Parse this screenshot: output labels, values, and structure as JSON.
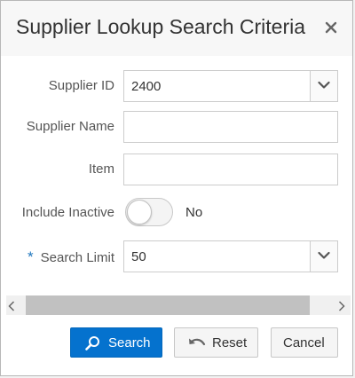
{
  "dialog": {
    "title": "Supplier Lookup Search Criteria"
  },
  "form": {
    "supplier_id": {
      "label": "Supplier ID",
      "value": "2400"
    },
    "supplier_name": {
      "label": "Supplier Name",
      "value": ""
    },
    "item": {
      "label": "Item",
      "value": ""
    },
    "include_inactive": {
      "label": "Include Inactive",
      "state": "No"
    },
    "search_limit": {
      "label": "Search Limit",
      "required_marker": "*",
      "value": "50"
    }
  },
  "buttons": {
    "search": "Search",
    "reset": "Reset",
    "cancel": "Cancel"
  },
  "colors": {
    "primary": "#0572ce",
    "required": "#1f76bd"
  },
  "icons": {
    "close": "close-icon",
    "dropdown": "chevron-down-icon",
    "search": "search-icon",
    "reset": "undo-icon",
    "scroll_left": "chevron-left-icon",
    "scroll_right": "chevron-right-icon"
  }
}
